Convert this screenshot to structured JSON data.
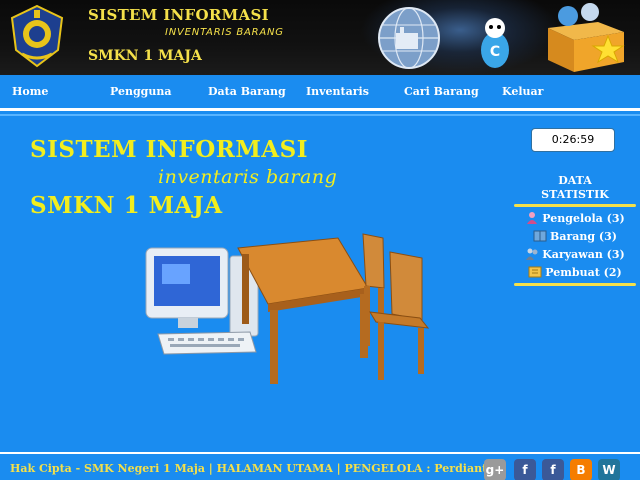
{
  "header": {
    "title": "SISTEM INFORMASI",
    "subtitle": "INVENTARIS BARANG",
    "school": "SMKN 1 MAJA"
  },
  "nav": {
    "items": [
      {
        "label": "Home"
      },
      {
        "label": "Pengguna"
      },
      {
        "label": "Data Barang"
      },
      {
        "label": "Inventaris"
      },
      {
        "label": "Cari Barang"
      },
      {
        "label": "Keluar"
      }
    ]
  },
  "main": {
    "heading": "SISTEM INFORMASI",
    "subheading": "inventaris barang",
    "school": "SMKN 1 MAJA"
  },
  "clock": {
    "time": "0:26:59"
  },
  "stats": {
    "title_line1": "DATA",
    "title_line2": "STATISTIK",
    "items": [
      {
        "label": "Pengelola (3)",
        "icon": "user-icon"
      },
      {
        "label": "Barang (3)",
        "icon": "box-icon"
      },
      {
        "label": "Karyawan (3)",
        "icon": "people-icon"
      },
      {
        "label": "Pembuat (2)",
        "icon": "book-icon"
      }
    ]
  },
  "footer": {
    "copyright": "Hak Cipta - SMK Negeri 1 Maja | HALAMAN UTAMA | PENGELOLA : Perdianto",
    "social": [
      {
        "name": "google-plus-icon",
        "glyph": "g+",
        "color": "#9a9a9a"
      },
      {
        "name": "facebook-icon",
        "glyph": "f",
        "color": "#3b5998"
      },
      {
        "name": "facebook-alt-icon",
        "glyph": "f",
        "color": "#3b5998"
      },
      {
        "name": "blogger-icon",
        "glyph": "B",
        "color": "#f57d00"
      },
      {
        "name": "wordpress-icon",
        "glyph": "W",
        "color": "#21759b"
      }
    ]
  },
  "colors": {
    "background": "#1a8cf0",
    "accent_yellow": "#f2ee1e",
    "banner": "#0a0a0a"
  }
}
